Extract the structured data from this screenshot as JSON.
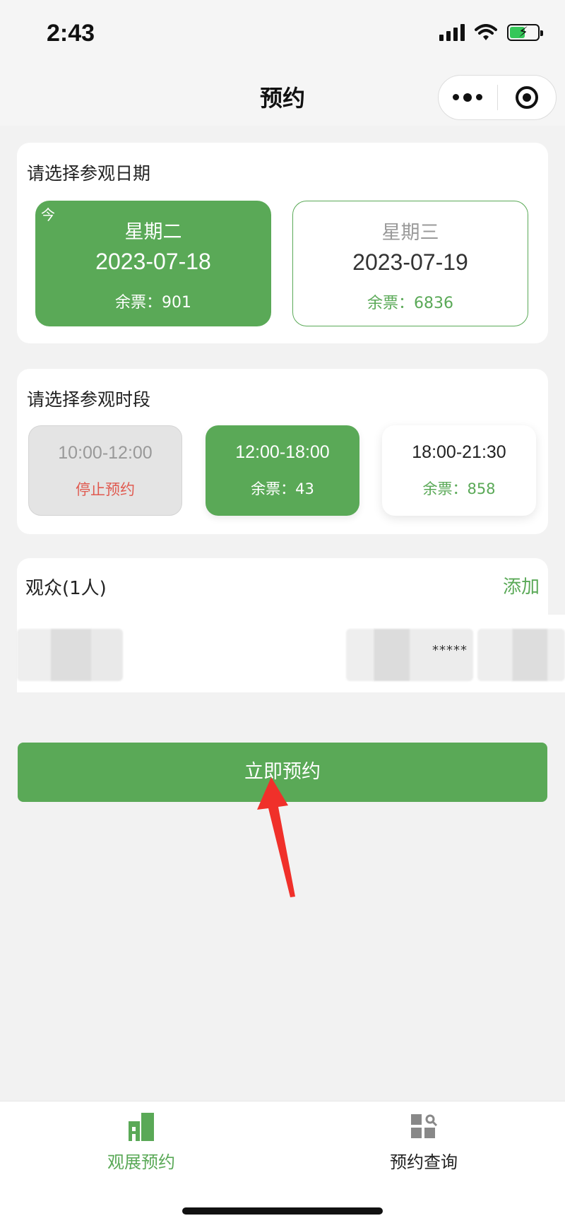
{
  "status_bar": {
    "time": "2:43"
  },
  "nav": {
    "title": "预约"
  },
  "date_section": {
    "title": "请选择参观日期",
    "dates": [
      {
        "today_tag": "今",
        "weekday": "星期二",
        "date": "2023-07-18",
        "tickets": "余票：901",
        "selected": true
      },
      {
        "weekday": "星期三",
        "date": "2023-07-19",
        "tickets": "余票：6836",
        "selected": false
      }
    ]
  },
  "time_section": {
    "title": "请选择参观时段",
    "slots": [
      {
        "range": "10:00-12:00",
        "sub": "停止预约",
        "state": "disabled"
      },
      {
        "range": "12:00-18:00",
        "sub": "余票：43",
        "state": "selected"
      },
      {
        "range": "18:00-21:30",
        "sub": "余票：858",
        "state": "available"
      }
    ]
  },
  "visitors": {
    "title": "观众(1人)",
    "add_label": "添加",
    "masked_id": "*****"
  },
  "actions": {
    "book_label": "立即预约"
  },
  "tabbar": {
    "items": [
      {
        "label": "观展预约",
        "icon": "building-icon",
        "active": true
      },
      {
        "label": "预约查询",
        "icon": "grid-search-icon",
        "active": false
      }
    ]
  },
  "colors": {
    "accent": "#5aa957",
    "warning": "#e05a50",
    "annotation_arrow": "#f0302a"
  }
}
